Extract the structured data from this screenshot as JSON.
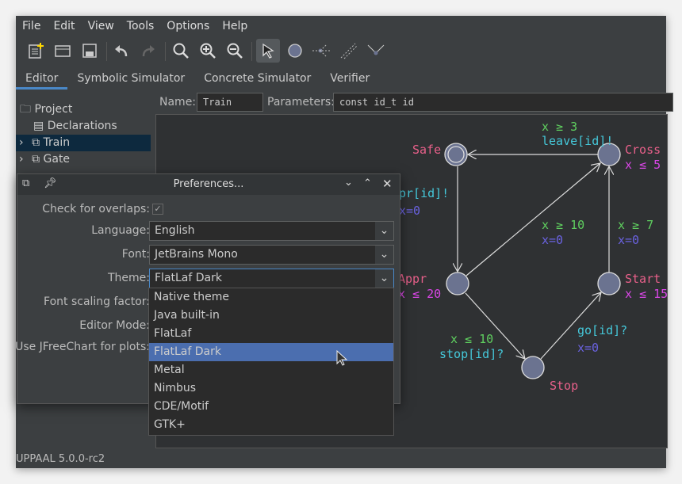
{
  "menu": [
    "File",
    "Edit",
    "View",
    "Tools",
    "Options",
    "Help"
  ],
  "toolbar": {
    "icons": [
      "new-document-icon",
      "open-icon",
      "save-icon",
      "undo-icon",
      "redo-icon",
      "zoom-fit-icon",
      "zoom-in-icon",
      "zoom-out-icon",
      "select-tool-icon",
      "add-location-icon",
      "add-branchpoint-icon",
      "add-edge-icon",
      "add-nail-icon"
    ],
    "selected": "select-tool-icon"
  },
  "tabs": [
    "Editor",
    "Symbolic Simulator",
    "Concrete Simulator",
    "Verifier"
  ],
  "tree": {
    "items": [
      "Project",
      "Declarations",
      "Train",
      "Gate"
    ],
    "selected": "Train"
  },
  "template": {
    "name_label": "Name:",
    "name_value": "Train",
    "params_label": "Parameters:",
    "params_value": "const id_t id"
  },
  "graph": {
    "locations": [
      {
        "name": "Safe",
        "initial": true,
        "invariant": ""
      },
      {
        "name": "Cross",
        "invariant": "x ≤ 5"
      },
      {
        "name": "Appr",
        "invariant": "x ≤ 20"
      },
      {
        "name": "Start",
        "invariant": "x ≤ 15"
      },
      {
        "name": "Stop",
        "invariant": ""
      }
    ],
    "edges": {
      "cross_safe": {
        "guard": "x ≥ 3",
        "sync": "leave[id]!"
      },
      "safe_appr": {
        "sync": "pr[id]!",
        "assign": "x=0"
      },
      "appr_cross": {
        "guard": "x ≥ 10",
        "assign": "x=0"
      },
      "start_cross": {
        "guard": "x ≥ 7",
        "assign": "x=0"
      },
      "appr_stop": {
        "guard": "x ≤ 10",
        "sync": "stop[id]?"
      },
      "stop_start": {
        "sync": "go[id]?",
        "assign": "x=0"
      }
    },
    "colors": {
      "name": "#e8608a",
      "invariant": "#d946e6",
      "guard": "#5fcf5f",
      "sync": "#45c8da",
      "assign": "#6a62e0",
      "node": "#6b7390"
    }
  },
  "dialog": {
    "title": "Preferences...",
    "labels": {
      "overlaps": "Check for overlaps:",
      "language": "Language:",
      "font": "Font:",
      "theme": "Theme:",
      "scaling": "Font scaling factor:",
      "mode": "Editor Mode:",
      "jfree": "Use JFreeChart for plots:"
    },
    "overlaps_checked": true,
    "language": "English",
    "font": "JetBrains Mono",
    "theme": "FlatLaf Dark",
    "theme_options": [
      "Native theme",
      "Java built-in",
      "FlatLaf",
      "FlatLaf Dark",
      "Metal",
      "Nimbus",
      "CDE/Motif",
      "GTK+"
    ],
    "highlighted": "FlatLaf Dark"
  },
  "status": "UPPAAL 5.0.0-rc2"
}
